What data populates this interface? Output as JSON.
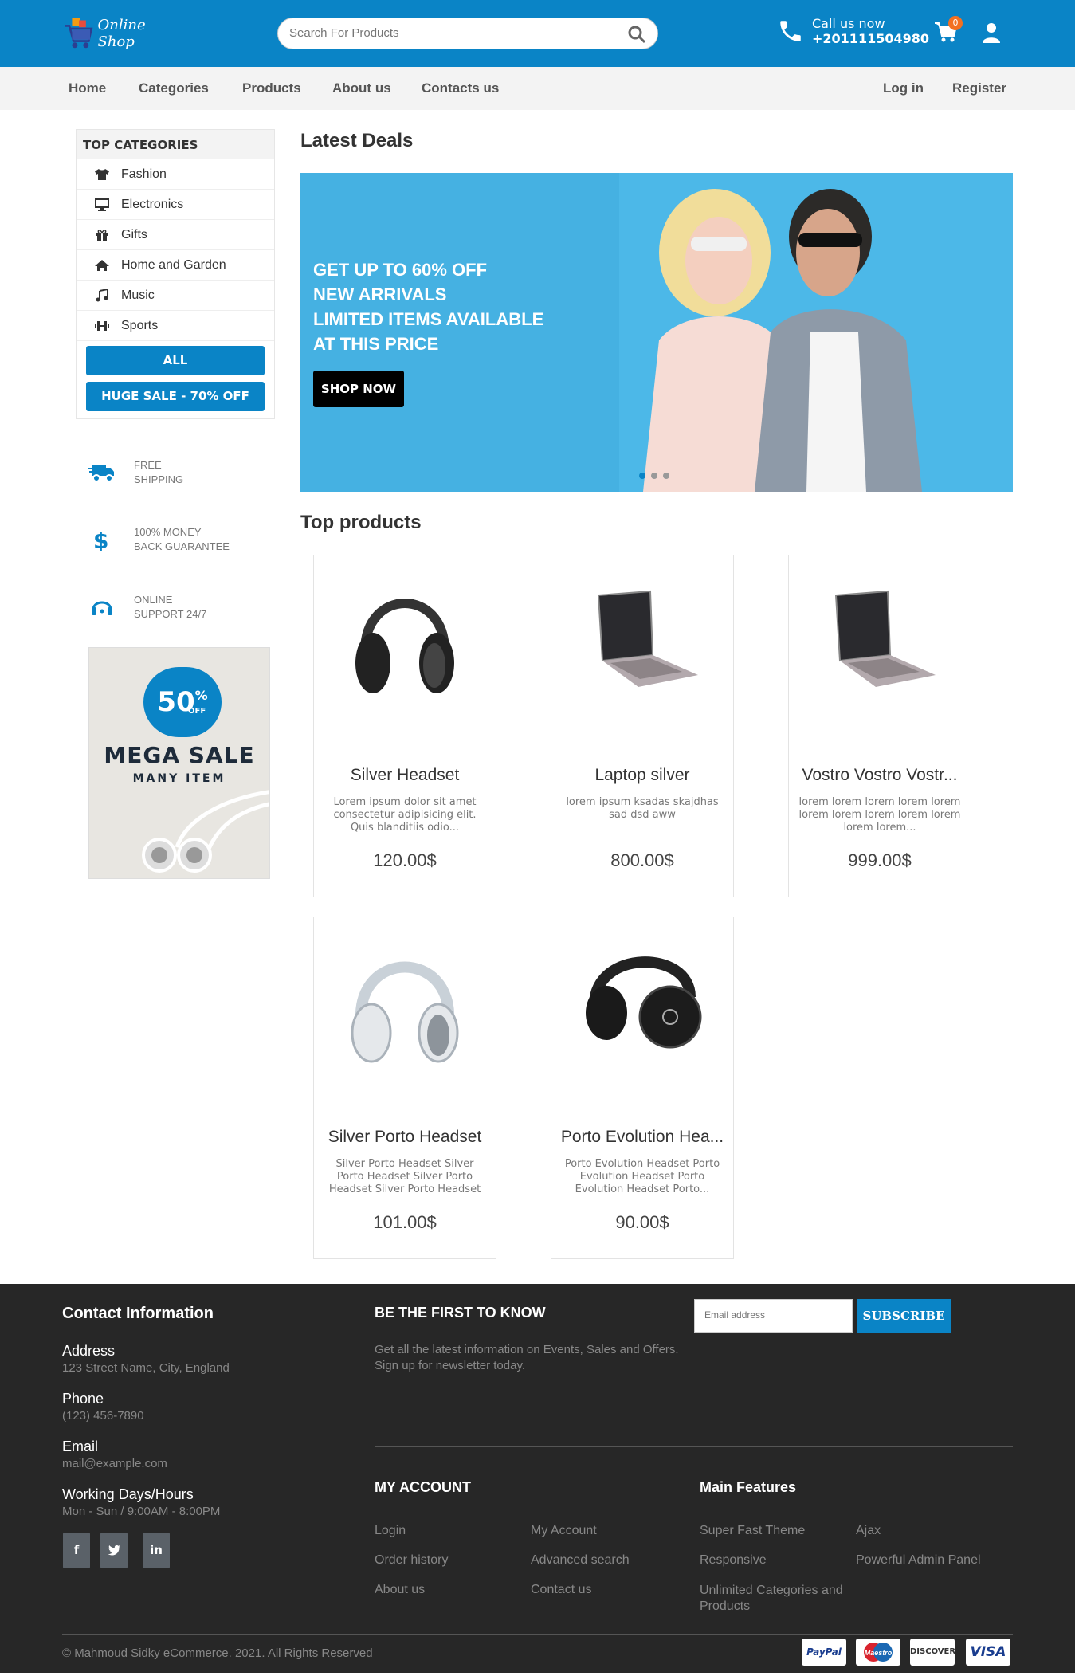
{
  "header": {
    "logo_text": "Online Shop",
    "search_placeholder": "Search For Products",
    "call_label": "Call us now",
    "call_number": "+201111504980",
    "cart_count": "0"
  },
  "nav": {
    "left": [
      "Home",
      "Categories",
      "Products",
      "About us",
      "Contacts us"
    ],
    "right": [
      "Log in",
      "Register"
    ]
  },
  "sidebar": {
    "title": "TOP CATEGORIES",
    "categories": [
      {
        "label": "Fashion",
        "icon": "tshirt-icon"
      },
      {
        "label": "Electronics",
        "icon": "desktop-icon"
      },
      {
        "label": "Gifts",
        "icon": "gift-icon"
      },
      {
        "label": "Home and Garden",
        "icon": "home-icon"
      },
      {
        "label": "Music",
        "icon": "music-icon"
      },
      {
        "label": "Sports",
        "icon": "dumbbell-icon"
      }
    ],
    "all_button": "ALL",
    "sale_button": "HUGE SALE - 70% OFF",
    "features": [
      {
        "line1": "FREE",
        "line2": "SHIPPING",
        "icon": "truck-icon"
      },
      {
        "line1": "100% MONEY",
        "line2": "BACK GUARANTEE",
        "icon": "dollar-icon"
      },
      {
        "line1": "ONLINE",
        "line2": "SUPPORT 24/7",
        "icon": "headset-icon"
      }
    ],
    "promo": {
      "percent": "50",
      "pct_sign": "%",
      "off": "OFF",
      "title": "MEGA SALE",
      "subtitle": "MANY ITEM"
    }
  },
  "main": {
    "latest_title": "Latest Deals",
    "banner": {
      "lines": [
        "GET UP TO 60% OFF",
        "NEW ARRIVALS",
        "LIMITED ITEMS AVAILABLE",
        "AT THIS PRICE"
      ],
      "button": "SHOP NOW"
    },
    "top_title": "Top products",
    "products": [
      {
        "name": "Silver Headset",
        "desc": "Lorem ipsum dolor sit amet consectetur adipisicing elit. Quis blanditiis odio...",
        "price": "120.00$",
        "image": "headphones-black"
      },
      {
        "name": "Laptop silver",
        "desc": "lorem ipsum ksadas skajdhas sad dsd aww",
        "price": "800.00$",
        "image": "laptop"
      },
      {
        "name": "Vostro Vostro Vostr...",
        "desc": "lorem lorem lorem lorem lorem lorem lorem lorem lorem lorem lorem lorem...",
        "price": "999.00$",
        "image": "laptop"
      },
      {
        "name": "Silver Porto Headset",
        "desc": "Silver Porto Headset Silver Porto Headset Silver Porto Headset Silver Porto Headset",
        "price": "101.00$",
        "image": "headphones-white"
      },
      {
        "name": "Porto Evolution Hea...",
        "desc": "Porto Evolution Headset Porto Evolution Headset Porto Evolution Headset Porto...",
        "price": "90.00$",
        "image": "headphones-black2"
      }
    ]
  },
  "footer": {
    "contact_title": "Contact Information",
    "address_label": "Address",
    "address": "123 Street Name, City, England",
    "phone_label": "Phone",
    "phone": "(123) 456-7890",
    "email_label": "Email",
    "email": "mail@example.com",
    "hours_label": "Working Days/Hours",
    "hours": "Mon - Sun / 9:00AM - 8:00PM",
    "social": [
      "f",
      "t",
      "in"
    ],
    "newsletter_title": "BE THE FIRST TO KNOW",
    "newsletter_text1": "Get all the latest information on Events, Sales and Offers.",
    "newsletter_text2": "Sign up for newsletter today.",
    "email_placeholder": "Email address",
    "subscribe": "SUBSCRIBE",
    "account_title": "MY ACCOUNT",
    "account_col1": [
      "Login",
      "Order history",
      "About us"
    ],
    "account_col2": [
      "My Account",
      "Advanced search",
      "Contact us"
    ],
    "features_title": "Main Features",
    "features_col1": [
      "Super Fast Theme",
      "Responsive",
      "Unlimited Categories and Products"
    ],
    "features_col2": [
      "Ajax",
      "Powerful Admin Panel"
    ],
    "copyright": "© Mahmoud Sidky eCommerce. 2021. All Rights Reserved",
    "payments": [
      "PayPal",
      "Maestro",
      "DISCOVER",
      "VISA"
    ]
  }
}
